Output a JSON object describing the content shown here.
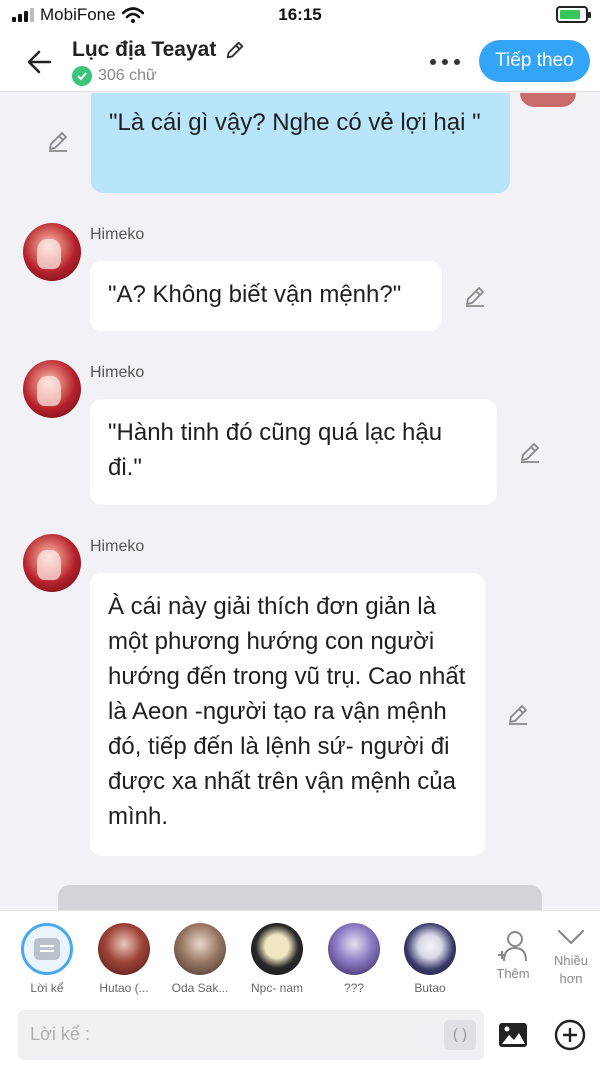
{
  "status_bar": {
    "carrier": "MobiFone",
    "time": "16:15"
  },
  "header": {
    "title": "Lục địa Teayat",
    "word_count": "306 chữ",
    "next_label": "Tiếp theo"
  },
  "messages": [
    {
      "speaker": "",
      "text": "\"Là cái gì vậy? Nghe có vẻ lợi hại \""
    },
    {
      "speaker": "Himeko",
      "text": "\"A? Không biết vận mệnh?\""
    },
    {
      "speaker": "Himeko",
      "text": "\"Hành tinh đó cũng quá lạc hậu đi.\""
    },
    {
      "speaker": "Himeko",
      "text": "À cái này giải thích đơn giản là một phương hướng con người hướng đến trong vũ trụ. Cao nhất là Aeon -người tạo ra vận mệnh đó, tiếp đến là lệnh sứ- người đi được xa nhất trên vận mệnh của mình."
    }
  ],
  "characters": [
    {
      "label": "Lời kể",
      "color": "#4aa8ef"
    },
    {
      "label": "Hutao (...",
      "color": "#7a2a25"
    },
    {
      "label": "Oda Sak...",
      "color": "#8a6a5a"
    },
    {
      "label": "Npc- nam",
      "color": "#2a2a2a"
    },
    {
      "label": "???",
      "color": "#6a5aa8"
    },
    {
      "label": "Butao",
      "color": "#3a3a6a"
    }
  ],
  "actions": {
    "add_label": "Thêm",
    "more_label": "Nhiều hơn"
  },
  "input": {
    "placeholder": "Lời kể :",
    "paren": "( )"
  },
  "colors": {
    "accent": "#34a4f6",
    "self_bubble": "#b8e5f9",
    "check": "#3bc47a"
  }
}
